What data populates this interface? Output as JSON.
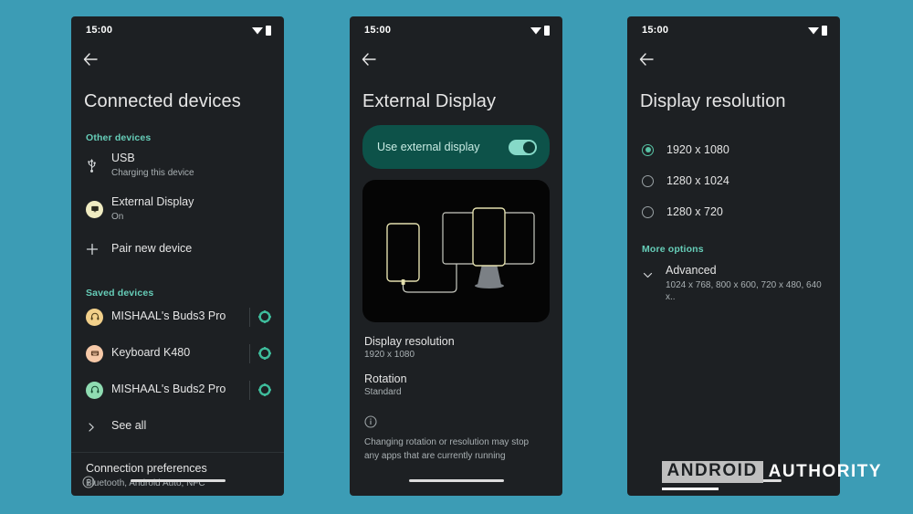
{
  "background_color": "#3c9cb5",
  "accent_color": "#66cdb8",
  "status_bar": {
    "time": "15:00",
    "wifi_icon": "wifi-icon",
    "battery_icon": "battery-icon"
  },
  "screen1": {
    "back_icon": "back-arrow-icon",
    "title": "Connected devices",
    "other_devices_label": "Other devices",
    "other_devices": [
      {
        "icon": "usb-icon",
        "title": "USB",
        "subtitle": "Charging this device"
      },
      {
        "icon": "external-display-icon",
        "title": "External Display",
        "subtitle": "On"
      },
      {
        "icon": "plus-icon",
        "title": "Pair new device",
        "subtitle": ""
      }
    ],
    "saved_devices_label": "Saved devices",
    "saved_devices": [
      {
        "icon": "headphones-icon",
        "title": "MISHAAL's Buds3 Pro",
        "gear": "gear-icon"
      },
      {
        "icon": "keyboard-icon",
        "title": "Keyboard K480",
        "gear": "gear-icon"
      },
      {
        "icon": "headphones-icon",
        "title": "MISHAAL's Buds2 Pro",
        "gear": "gear-icon"
      }
    ],
    "see_all": "See all",
    "see_all_icon": "chevron-right-icon",
    "preferences_title": "Connection preferences",
    "preferences_sub": "Bluetooth, Android Auto, NFC",
    "info_icon": "info-icon"
  },
  "screen2": {
    "back_icon": "back-arrow-icon",
    "title": "External Display",
    "toggle_label": "Use external display",
    "toggle_state": "on",
    "illustration": "phone-connected-to-monitor-illustration",
    "resolution_title": "Display resolution",
    "resolution_value": "1920 x 1080",
    "rotation_title": "Rotation",
    "rotation_value": "Standard",
    "note_icon": "info-icon",
    "note": "Changing rotation or resolution may stop any apps that are currently running"
  },
  "screen3": {
    "back_icon": "back-arrow-icon",
    "title": "Display resolution",
    "options": [
      {
        "label": "1920 x 1080",
        "selected": true
      },
      {
        "label": "1280 x 1024",
        "selected": false
      },
      {
        "label": "1280 x 720",
        "selected": false
      }
    ],
    "more_options_label": "More options",
    "advanced_icon": "chevron-down-icon",
    "advanced_title": "Advanced",
    "advanced_sub": "1024 x 768, 800 x 600, 720 x 480, 640 x.."
  },
  "watermark": {
    "word1": "ANDROID",
    "word2": "AUTHORITY"
  }
}
